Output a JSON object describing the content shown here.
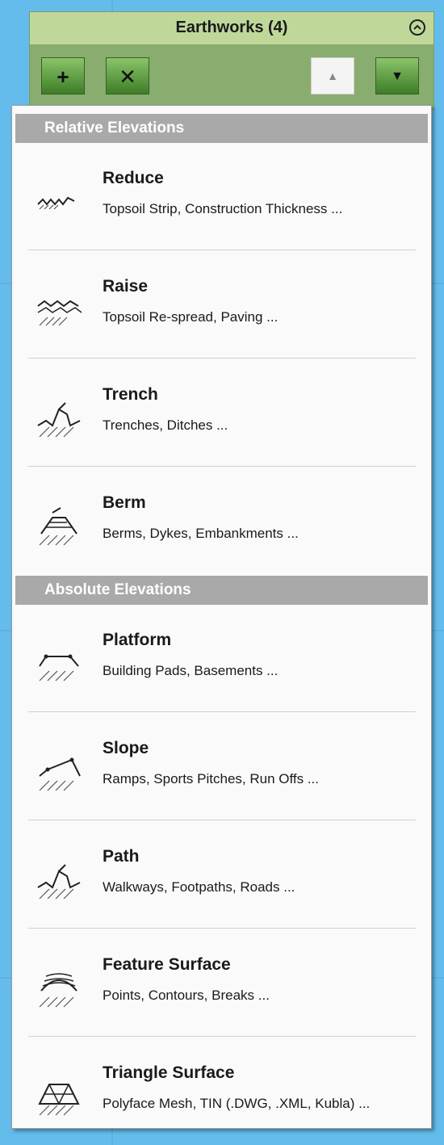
{
  "panel": {
    "title": "Earthworks (4)",
    "buttons": [
      {
        "name": "add-button",
        "glyph": "+"
      },
      {
        "name": "delete-button",
        "glyph": "✕"
      },
      {
        "name": "move-up-button",
        "glyph": "▲"
      },
      {
        "name": "move-down-button",
        "glyph": "▼"
      }
    ]
  },
  "sections": [
    {
      "header": "Relative Elevations",
      "items": [
        {
          "title": "Reduce",
          "desc": "Topsoil Strip, Construction Thickness ...",
          "icon": "reduce-icon"
        },
        {
          "title": "Raise",
          "desc": "Topsoil Re-spread, Paving ...",
          "icon": "raise-icon"
        },
        {
          "title": "Trench",
          "desc": "Trenches, Ditches ...",
          "icon": "trench-icon"
        },
        {
          "title": "Berm",
          "desc": "Berms, Dykes, Embankments ...",
          "icon": "berm-icon"
        }
      ]
    },
    {
      "header": "Absolute Elevations",
      "items": [
        {
          "title": "Platform",
          "desc": "Building Pads, Basements ...",
          "icon": "platform-icon"
        },
        {
          "title": "Slope",
          "desc": "Ramps, Sports Pitches, Run Offs ...",
          "icon": "slope-icon"
        },
        {
          "title": "Path",
          "desc": "Walkways, Footpaths, Roads ...",
          "icon": "path-icon"
        },
        {
          "title": "Feature Surface",
          "desc": "Points, Contours, Breaks ...",
          "icon": "feature-surface-icon"
        },
        {
          "title": "Triangle Surface",
          "desc": "Polyface Mesh, TIN (.DWG, .XML, Kubla) ...",
          "icon": "triangle-surface-icon"
        }
      ]
    }
  ],
  "colors": {
    "background": "#64bcec",
    "panel_header": "#bfd899",
    "panel_body": "#89ad6f",
    "button_green": "#3d7e27",
    "section_header": "#a9a9a9"
  }
}
